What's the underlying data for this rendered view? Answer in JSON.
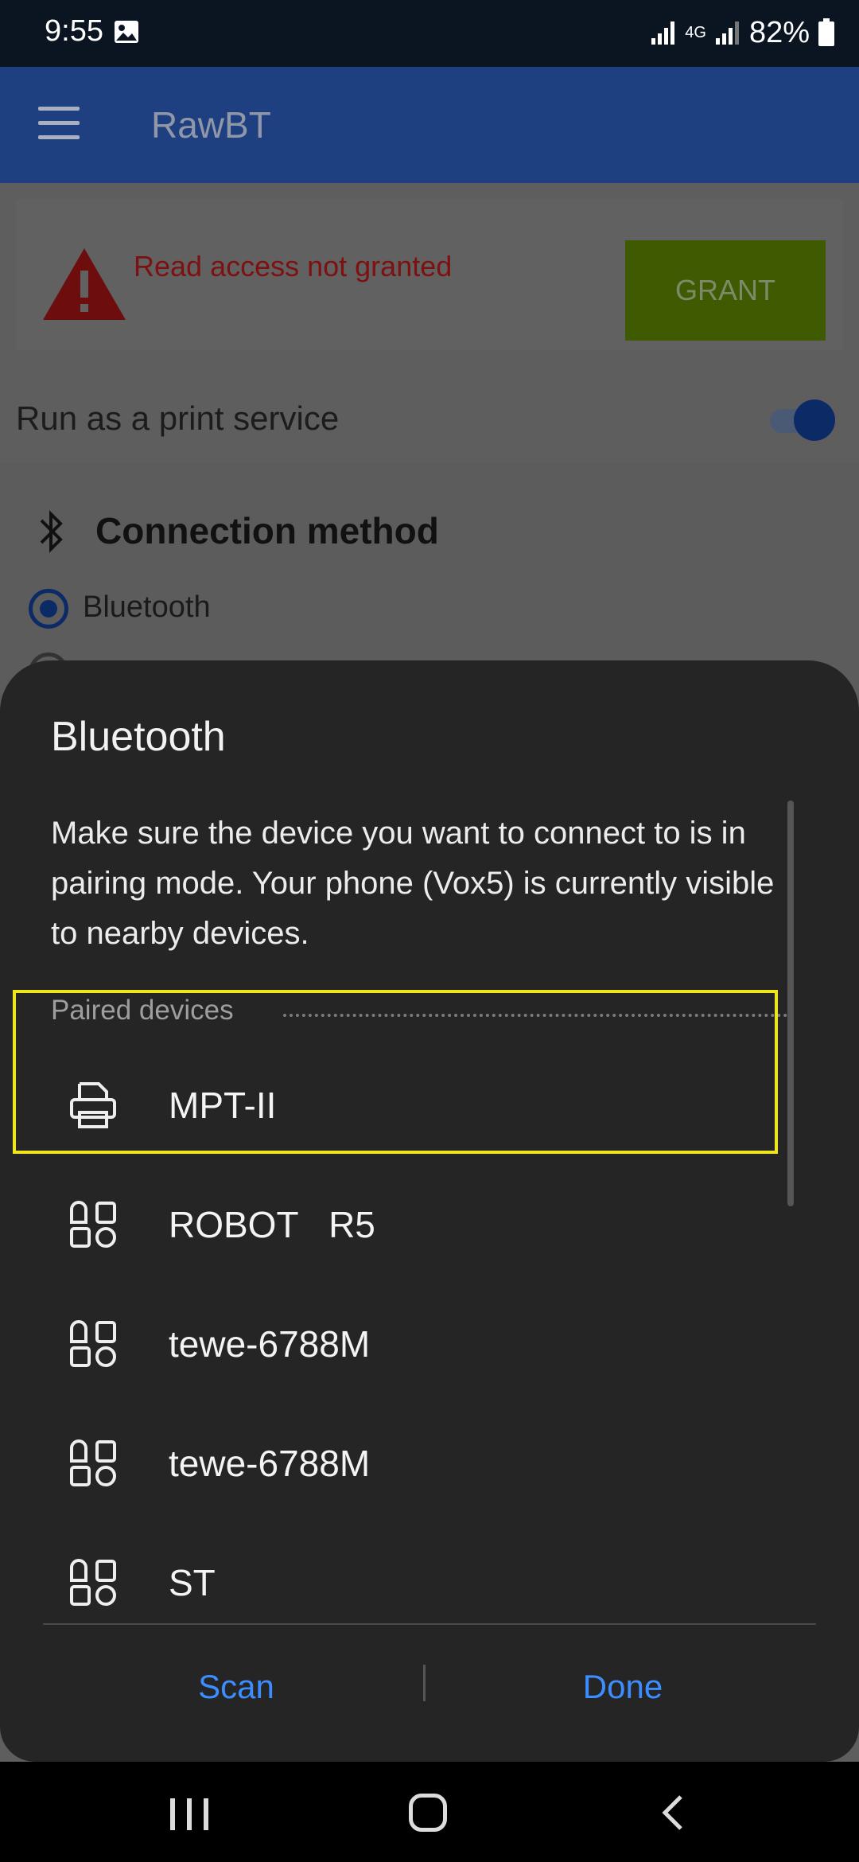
{
  "status_bar": {
    "time": "9:55",
    "battery": "82%",
    "network": "4G"
  },
  "app_bar": {
    "title": "RawBT"
  },
  "warning": {
    "message": "Read access not granted",
    "button_label": "GRANT"
  },
  "print_service": {
    "label": "Run as a print service",
    "enabled": true
  },
  "connection": {
    "title": "Connection method",
    "selected_option": "Bluetooth"
  },
  "dialog": {
    "title": "Bluetooth",
    "description": "Make sure the device you want to connect to is in pairing mode. Your phone (Vox5) is currently visible to nearby devices.",
    "section_label": "Paired devices",
    "devices": [
      {
        "name": "MPT-II",
        "icon": "printer-icon"
      },
      {
        "name": "ROBOT   R5",
        "icon": "generic-device-icon"
      },
      {
        "name": "tewe-6788M",
        "icon": "generic-device-icon"
      },
      {
        "name": "tewe-6788M",
        "icon": "generic-device-icon"
      },
      {
        "name": "ST",
        "icon": "generic-device-icon"
      }
    ],
    "scan_label": "Scan",
    "done_label": "Done"
  },
  "colors": {
    "accent_blue": "#3c8dff",
    "appbar": "#1e3f80",
    "highlight": "#f0e51a"
  }
}
